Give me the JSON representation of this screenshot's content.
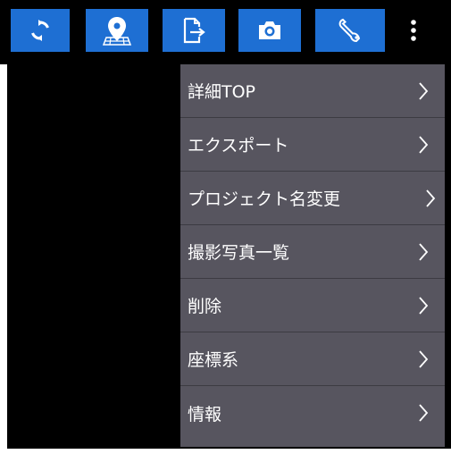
{
  "toolbar": {
    "buttons": [
      {
        "icon": "sync-icon"
      },
      {
        "icon": "map-pin-icon"
      },
      {
        "icon": "export-file-icon"
      },
      {
        "icon": "camera-icon"
      },
      {
        "icon": "wrench-icon"
      }
    ],
    "more_icon": "more-vertical-icon",
    "accent": "#1e6fd3"
  },
  "menu": {
    "items": [
      {
        "label": "詳細TOP"
      },
      {
        "label": "エクスポート"
      },
      {
        "label": "プロジェクト名変更"
      },
      {
        "label": "撮影写真一覧"
      },
      {
        "label": "削除"
      },
      {
        "label": "座標系"
      },
      {
        "label": "情報"
      }
    ],
    "background": "#57555f"
  }
}
